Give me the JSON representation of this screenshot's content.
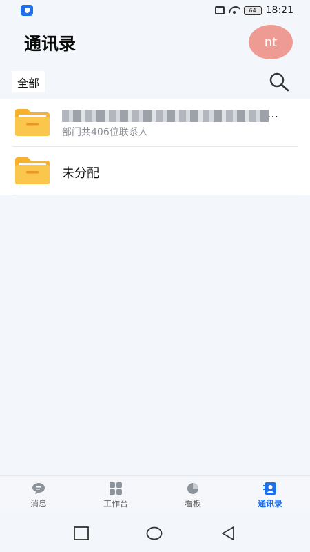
{
  "status_bar": {
    "battery": "64",
    "time": "18:21"
  },
  "header": {
    "title": "通讯录",
    "avatar_text": "nt"
  },
  "filter": {
    "all_label": "全部"
  },
  "list": {
    "items": [
      {
        "title": "█████████████████",
        "subtitle": "部门共406位联系人",
        "icon": "folder-icon"
      },
      {
        "title": "未分配",
        "icon": "folder-icon"
      }
    ]
  },
  "bottom_nav": {
    "items": [
      {
        "label": "消息",
        "icon": "message-icon"
      },
      {
        "label": "工作台",
        "icon": "grid-icon"
      },
      {
        "label": "看板",
        "icon": "pie-chart-icon"
      },
      {
        "label": "通讯录",
        "icon": "contacts-icon",
        "active": true
      }
    ]
  },
  "colors": {
    "accent": "#1e6fe8",
    "avatar_bg": "#ee9c93",
    "folder": "#f9b433",
    "background": "#f3f6fa"
  }
}
